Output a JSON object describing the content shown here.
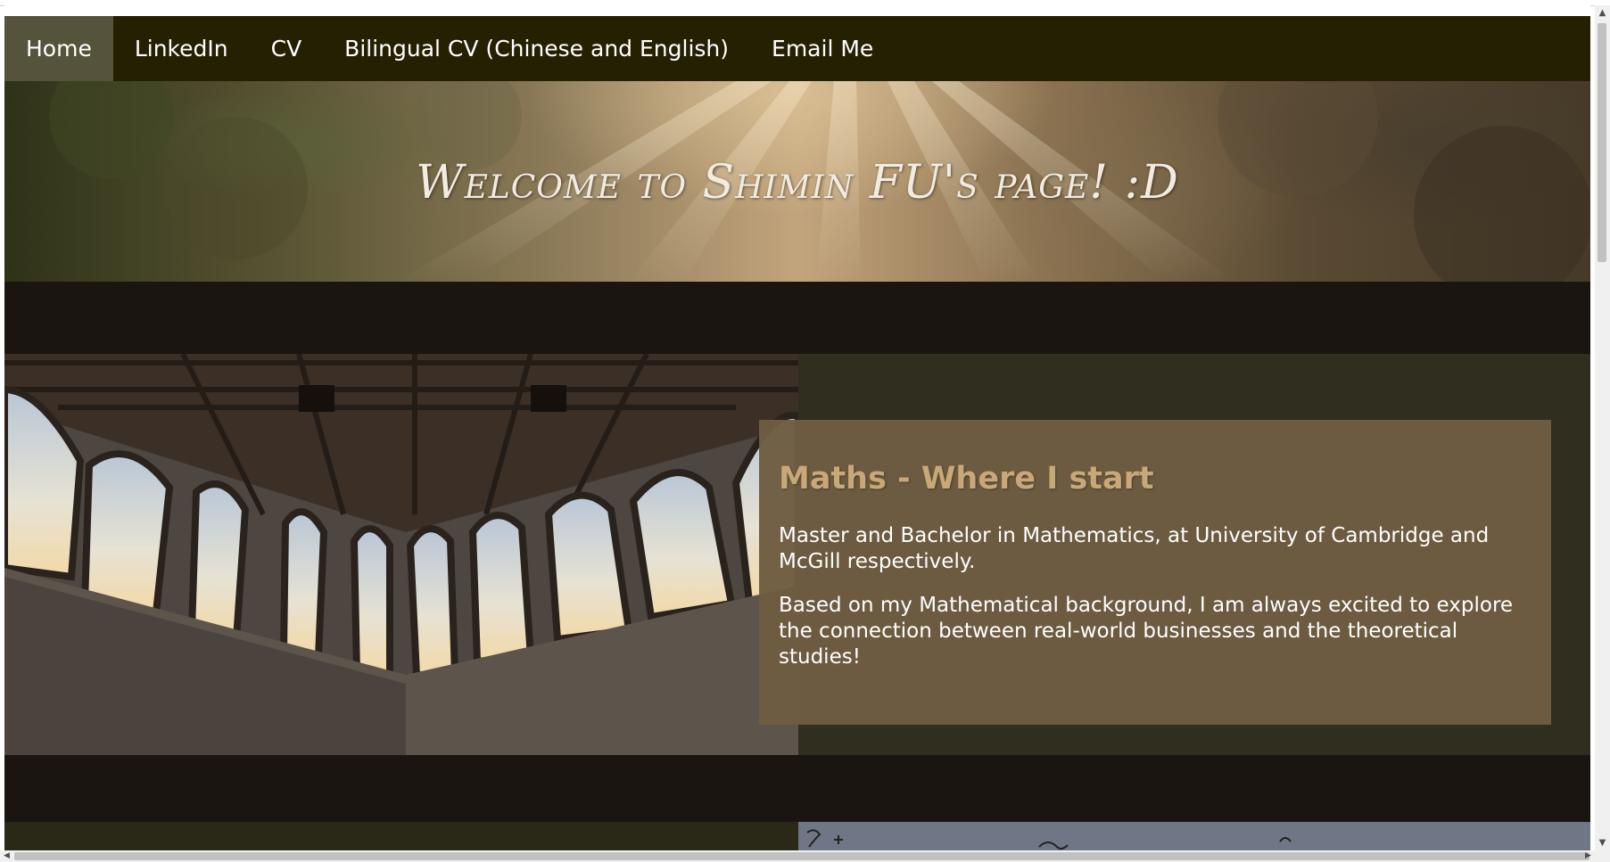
{
  "nav": {
    "items": [
      {
        "label": "Home",
        "active": true
      },
      {
        "label": "LinkedIn",
        "active": false
      },
      {
        "label": "CV",
        "active": false
      },
      {
        "label": "Bilingual CV (Chinese and English)",
        "active": false
      },
      {
        "label": "Email Me",
        "active": false
      }
    ]
  },
  "banner": {
    "title": "Welcome to Shimin FU's page! :D"
  },
  "sections": [
    {
      "title": "Maths - Where I start",
      "paragraphs": [
        "Master and Bachelor in Mathematics, at University of Cambridge and McGill respectively.",
        "Based on my Mathematical background, I am always excited to explore the connection between real-world businesses and the theoretical studies!"
      ]
    }
  ],
  "colors": {
    "nav_background": "#262003",
    "nav_active": "#55533c",
    "page_background": "#1a1510",
    "section_background": "#2f2e1f",
    "caption_background": "#6e5d42",
    "caption_title": "#c8a878"
  },
  "icons": {
    "scroll_up": "triangle-up-icon",
    "scroll_down": "triangle-down-icon",
    "scroll_left": "triangle-left-icon",
    "scroll_right": "triangle-right-icon"
  }
}
